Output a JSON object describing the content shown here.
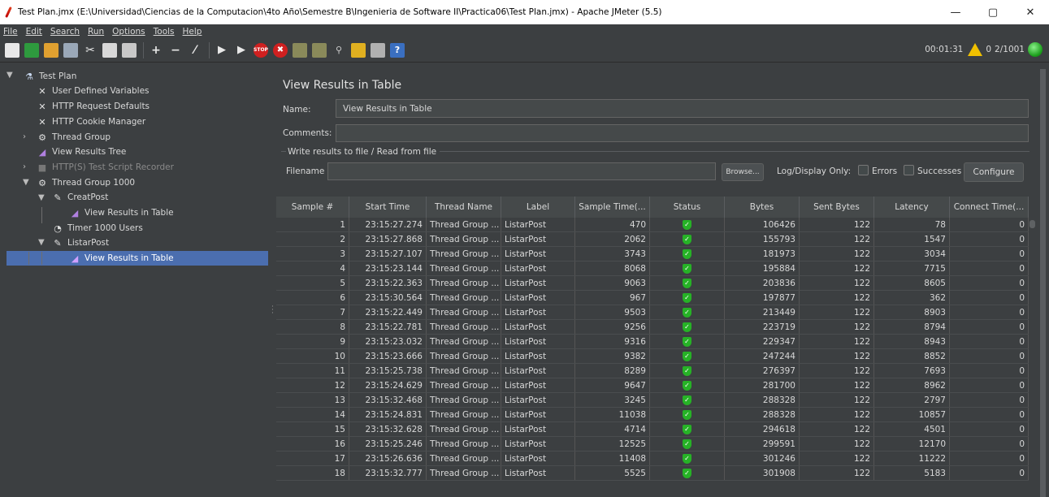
{
  "window": {
    "title": "Test Plan.jmx (E:\\Universidad\\Ciencias de la Computacion\\4to Año\\Semestre B\\Ingenieria de Software II\\Practica06\\Test Plan.jmx) - Apache JMeter (5.5)",
    "min": "—",
    "max": "▢",
    "close": "✕"
  },
  "menu": [
    "File",
    "Edit",
    "Search",
    "Run",
    "Options",
    "Tools",
    "Help"
  ],
  "toolbar": {
    "elapsed": "00:01:31",
    "errors": "0",
    "threads": "2/1001",
    "stop_label": "STOP"
  },
  "tree": {
    "items": [
      {
        "label": "Test Plan",
        "icon": "flask-icon"
      },
      {
        "label": "User Defined Variables",
        "icon": "wrench-icon"
      },
      {
        "label": "HTTP Request Defaults",
        "icon": "wrench-icon"
      },
      {
        "label": "HTTP Cookie Manager",
        "icon": "wrench-icon"
      },
      {
        "label": "Thread Group",
        "icon": "gear-icon"
      },
      {
        "label": "View Results Tree",
        "icon": "chart-icon"
      },
      {
        "label": "HTTP(S) Test Script Recorder",
        "icon": "recorder-icon"
      },
      {
        "label": "Thread Group 1000",
        "icon": "gear-icon"
      },
      {
        "label": "CreatPost",
        "icon": "pen-icon"
      },
      {
        "label": "View Results in Table",
        "icon": "chart-icon"
      },
      {
        "label": "Timer 1000 Users",
        "icon": "clock-icon"
      },
      {
        "label": "ListarPost",
        "icon": "pen-icon"
      },
      {
        "label": "View Results in Table",
        "icon": "chart-icon"
      }
    ]
  },
  "panel": {
    "title": "View Results in Table",
    "name_label": "Name:",
    "name_value": "View Results in Table",
    "comments_label": "Comments:",
    "comments_value": "",
    "section_label": "Write results to file / Read from file",
    "filename_label": "Filename",
    "filename_value": "",
    "browse_label": "Browse...",
    "log_display_label": "Log/Display Only:",
    "errors_label": "Errors",
    "successes_label": "Successes",
    "configure_label": "Configure"
  },
  "table": {
    "columns": [
      "Sample #",
      "Start Time",
      "Thread Name",
      "Label",
      "Sample Time(...",
      "Status",
      "Bytes",
      "Sent Bytes",
      "Latency",
      "Connect Time(..."
    ],
    "rows": [
      [
        "1",
        "23:15:27.274",
        "Thread Group ...",
        "ListarPost",
        "470",
        "106426",
        "122",
        "78",
        "0"
      ],
      [
        "2",
        "23:15:27.868",
        "Thread Group ...",
        "ListarPost",
        "2062",
        "155793",
        "122",
        "1547",
        "0"
      ],
      [
        "3",
        "23:15:27.107",
        "Thread Group ...",
        "ListarPost",
        "3743",
        "181973",
        "122",
        "3034",
        "0"
      ],
      [
        "4",
        "23:15:23.144",
        "Thread Group ...",
        "ListarPost",
        "8068",
        "195884",
        "122",
        "7715",
        "0"
      ],
      [
        "5",
        "23:15:22.363",
        "Thread Group ...",
        "ListarPost",
        "9063",
        "203836",
        "122",
        "8605",
        "0"
      ],
      [
        "6",
        "23:15:30.564",
        "Thread Group ...",
        "ListarPost",
        "967",
        "197877",
        "122",
        "362",
        "0"
      ],
      [
        "7",
        "23:15:22.449",
        "Thread Group ...",
        "ListarPost",
        "9503",
        "213449",
        "122",
        "8903",
        "0"
      ],
      [
        "8",
        "23:15:22.781",
        "Thread Group ...",
        "ListarPost",
        "9256",
        "223719",
        "122",
        "8794",
        "0"
      ],
      [
        "9",
        "23:15:23.032",
        "Thread Group ...",
        "ListarPost",
        "9316",
        "229347",
        "122",
        "8943",
        "0"
      ],
      [
        "10",
        "23:15:23.666",
        "Thread Group ...",
        "ListarPost",
        "9382",
        "247244",
        "122",
        "8852",
        "0"
      ],
      [
        "11",
        "23:15:25.738",
        "Thread Group ...",
        "ListarPost",
        "8289",
        "276397",
        "122",
        "7693",
        "0"
      ],
      [
        "12",
        "23:15:24.629",
        "Thread Group ...",
        "ListarPost",
        "9647",
        "281700",
        "122",
        "8962",
        "0"
      ],
      [
        "13",
        "23:15:32.468",
        "Thread Group ...",
        "ListarPost",
        "3245",
        "288328",
        "122",
        "2797",
        "0"
      ],
      [
        "14",
        "23:15:24.831",
        "Thread Group ...",
        "ListarPost",
        "11038",
        "288328",
        "122",
        "10857",
        "0"
      ],
      [
        "15",
        "23:15:32.628",
        "Thread Group ...",
        "ListarPost",
        "4714",
        "294618",
        "122",
        "4501",
        "0"
      ],
      [
        "16",
        "23:15:25.246",
        "Thread Group ...",
        "ListarPost",
        "12525",
        "299591",
        "122",
        "12170",
        "0"
      ],
      [
        "17",
        "23:15:26.636",
        "Thread Group ...",
        "ListarPost",
        "11408",
        "301246",
        "122",
        "11222",
        "0"
      ],
      [
        "18",
        "23:15:32.777",
        "Thread Group ...",
        "ListarPost",
        "5525",
        "301908",
        "122",
        "5183",
        "0"
      ]
    ]
  },
  "colors": {
    "background": "#3c3f41",
    "selection": "#4b6eaf",
    "status_ok": "#26b226"
  }
}
